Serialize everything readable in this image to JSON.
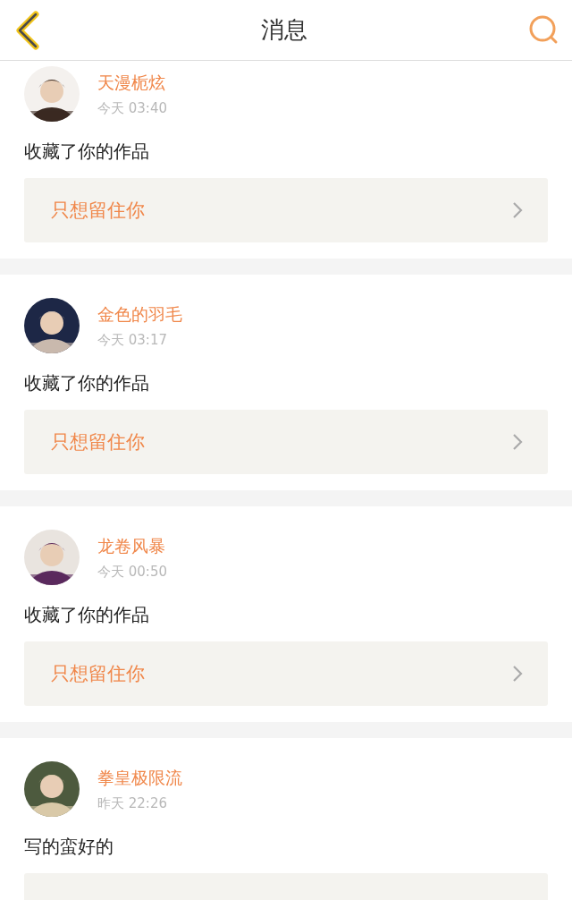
{
  "header": {
    "title": "消息"
  },
  "messages": [
    {
      "name": "天漫栀炫",
      "time": "今天 03:40",
      "text": "收藏了你的作品",
      "work": "只想留住你"
    },
    {
      "name": "金色的羽毛",
      "time": "今天 03:17",
      "text": "收藏了你的作品",
      "work": "只想留住你"
    },
    {
      "name": "龙卷风暴",
      "time": "今天 00:50",
      "text": "收藏了你的作品",
      "work": "只想留住你"
    },
    {
      "name": "拳皇极限流",
      "time": "昨天 22:26",
      "text": "写的蛮好的"
    }
  ]
}
